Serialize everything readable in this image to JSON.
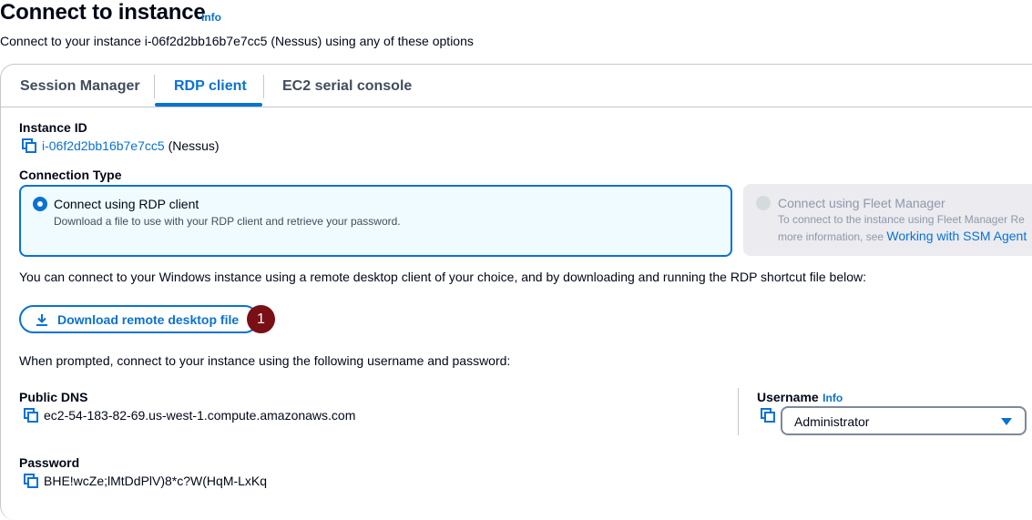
{
  "header": {
    "title": "Connect to instance",
    "info_label": "Info",
    "subtitle": "Connect to your instance i-06f2d2bb16b7e7cc5 (Nessus) using any of these options"
  },
  "tabs": [
    {
      "label": "Session Manager",
      "active": false
    },
    {
      "label": "RDP client",
      "active": true
    },
    {
      "label": "EC2 serial console",
      "active": false
    }
  ],
  "instance": {
    "label": "Instance ID",
    "id": "i-06f2d2bb16b7e7cc5",
    "name": "(Nessus)"
  },
  "connection_type": {
    "label": "Connection Type",
    "options": [
      {
        "title": "Connect using RDP client",
        "description": "Download a file to use with your RDP client and retrieve your password.",
        "selected": true
      },
      {
        "title": "Connect using Fleet Manager",
        "description": "To connect to the instance using Fleet Manager Re",
        "description2_prefix": "more information, see",
        "description2_link": "Working with SSM Agent",
        "selected": false,
        "disabled": true
      }
    ]
  },
  "rdp_text": "You can connect to your Windows instance using a remote desktop client of your choice, and by downloading and running the RDP shortcut file below:",
  "download_button": "Download remote desktop file",
  "step_badge": "1",
  "prompt_text": "When prompted, connect to your instance using the following username and password:",
  "public_dns": {
    "label": "Public DNS",
    "value": "ec2-54-183-82-69.us-west-1.compute.amazonaws.com"
  },
  "username": {
    "label": "Username",
    "info_label": "Info",
    "selected": "Administrator"
  },
  "password": {
    "label": "Password",
    "value": "BHE!wcZe;lMtDdPlV)8*c?W(HqM-LxKq"
  },
  "colors": {
    "accent": "#0972d3",
    "badge": "#7a0f16",
    "selected_tile_bg": "#f0fbff",
    "disabled_tile_bg": "#ebebf0"
  }
}
